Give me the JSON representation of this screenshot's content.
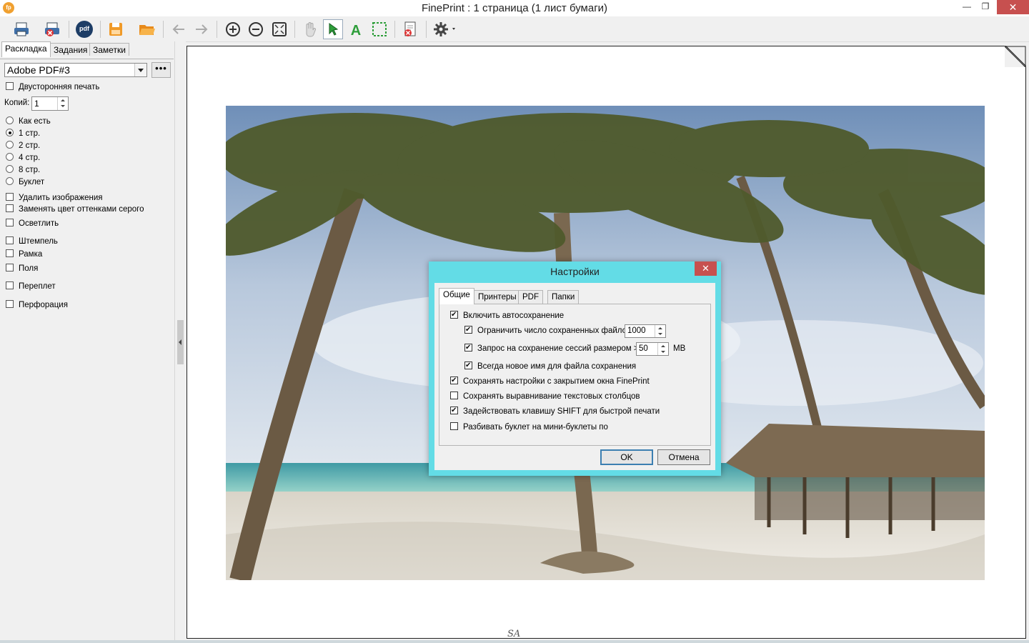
{
  "window": {
    "title": "FinePrint : 1 страница (1 лист бумаги)",
    "app_icon": "fp",
    "minimize": "—",
    "restore": "❐",
    "close": "✕"
  },
  "toolbar": {
    "icons": [
      "print-icon",
      "cancel-print-icon",
      "pdf-pro-icon",
      "save-icon",
      "open-folder-icon",
      "back-icon",
      "forward-icon",
      "zoom-in-icon",
      "zoom-out-icon",
      "fit-page-icon",
      "hand-icon",
      "select-arrow-icon",
      "text-tool-icon",
      "selection-rect-icon",
      "delete-page-icon",
      "settings-gear-icon"
    ],
    "pdf_label": "pdf"
  },
  "left_panel": {
    "tabs": [
      "Раскладка",
      "Задания",
      "Заметки"
    ],
    "active_tab": "Раскладка",
    "printer": "Adobe PDF#3",
    "more_button": "•••",
    "duplex_label": "Двусторонняя печать",
    "copies_label": "Копий:",
    "copies_value": "1",
    "layout_options": [
      {
        "label": "Как есть",
        "selected": false
      },
      {
        "label": "1 стр.",
        "selected": true
      },
      {
        "label": "2 стр.",
        "selected": false
      },
      {
        "label": "4 стр.",
        "selected": false
      },
      {
        "label": "8 стр.",
        "selected": false
      },
      {
        "label": "Буклет",
        "selected": false
      }
    ],
    "checkbox_options": [
      "Удалить изображения",
      "Заменять цвет оттенками серого",
      "Осветлить",
      "Штемпель",
      "Рамка",
      "Поля",
      "Переплет",
      "Перфорация"
    ]
  },
  "page_footer": "SA",
  "dialog": {
    "title": "Настройки",
    "close": "✕",
    "tabs": [
      "Общие",
      "Принтеры",
      "PDF",
      "Папки"
    ],
    "active_tab": "Общие",
    "options": {
      "autosave": {
        "label": "Включить автосохранение",
        "checked": true
      },
      "limit_files": {
        "label": "Ограничить число сохраненных файлов",
        "checked": true,
        "value": "1000"
      },
      "ask_session": {
        "label": "Запрос на сохранение сессий размером >",
        "checked": true,
        "value": "50",
        "unit": "MB"
      },
      "always_new_name": {
        "label": "Всегда новое имя для файла сохранения",
        "checked": true
      },
      "save_settings": {
        "label": "Сохранять настройки с закрытием окна FinePrint",
        "checked": true
      },
      "save_alignment": {
        "label": "Сохранять выравнивание текстовых столбцов",
        "checked": false
      },
      "shift_print": {
        "label": "Задействовать клавишу SHIFT для быстрой печати",
        "checked": true
      },
      "split_booklet": {
        "label": "Разбивать буклет на мини-буклеты по",
        "checked": false
      }
    },
    "ok_label": "OK",
    "cancel_label": "Отмена"
  },
  "colors": {
    "dialog_frame": "#63dce6",
    "close_button": "#c7504f",
    "accent_green": "#2e9e3a"
  }
}
